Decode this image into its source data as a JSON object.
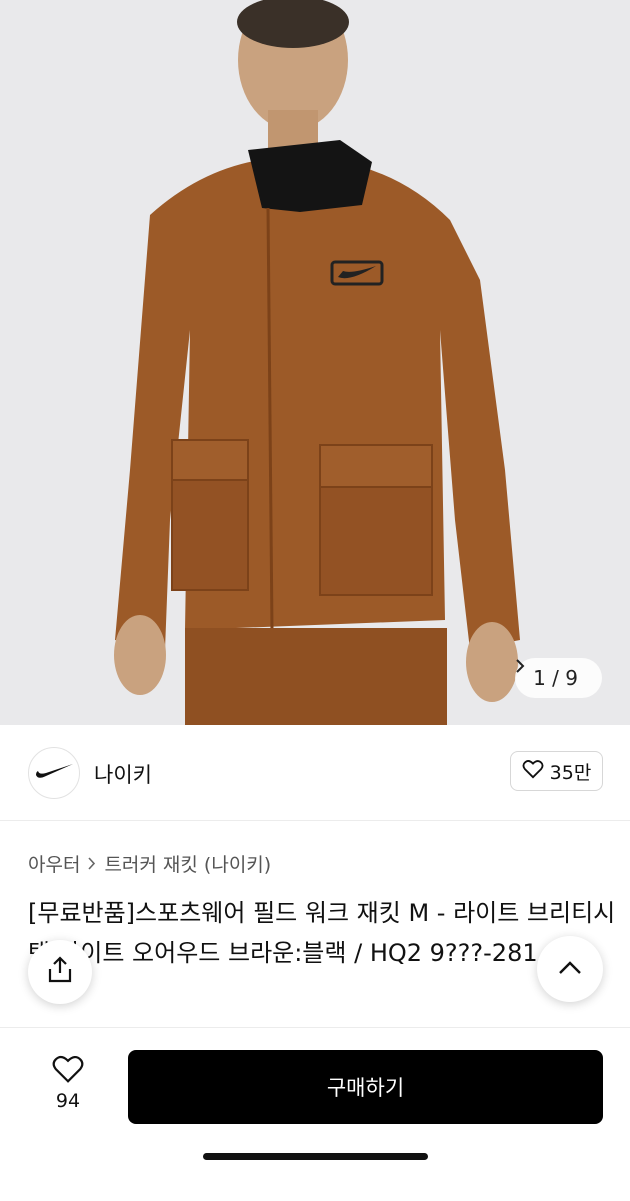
{
  "gallery": {
    "counter": "1 / 9",
    "next_icon": "chevron-right-icon"
  },
  "brand": {
    "logo_icon": "nike-swoosh-icon",
    "name": "나이키",
    "like_icon": "heart-outline-icon",
    "like_count": "35만"
  },
  "breadcrumb": {
    "category": "아우터",
    "separator_icon": "chevron-right-icon",
    "subcategory": "트러커 재킷 (나이키)"
  },
  "product": {
    "title": "[무료반품]스포츠웨어 필드 워크 재킷 M - 라이트 브리티시 탠:라이트 오어우드 브라운:블랙 / HQ2 9???-281"
  },
  "floating": {
    "share_icon": "share-icon",
    "scroll_top_icon": "chevron-up-icon"
  },
  "bottom_bar": {
    "wish_icon": "heart-outline-icon",
    "wish_count": "94",
    "buy_label": "구매하기"
  },
  "colors": {
    "jacket": "#9c5a28",
    "collar": "#141414",
    "background": "#e9e9eb",
    "buy_button": "#000000"
  }
}
